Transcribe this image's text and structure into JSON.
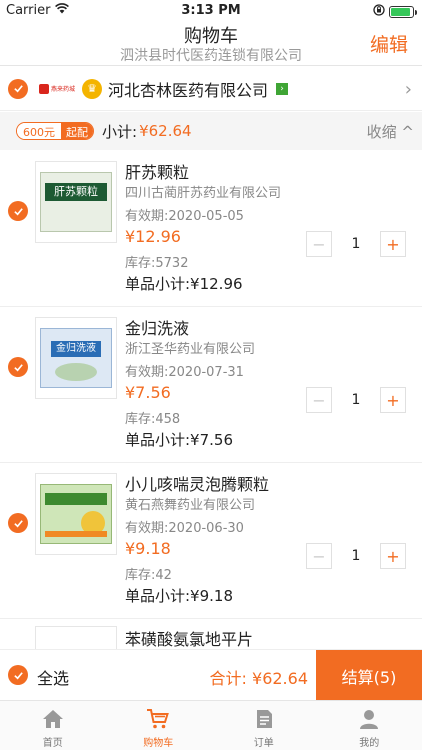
{
  "status_bar": {
    "carrier": "Carrier",
    "time": "3:13 PM",
    "battery_level": 0.9
  },
  "nav": {
    "title": "购物车",
    "subtitle": "泗洪县时代医药连锁有限公司",
    "edit_label": "编辑"
  },
  "shop": {
    "logo_text": "燕来药城",
    "name": "河北杏林医药有限公司"
  },
  "subtotal": {
    "min_amount": "600元",
    "min_tag": "起配",
    "label": "小计:",
    "value": "¥62.64",
    "collapse_label": "收缩"
  },
  "items": [
    {
      "name": "肝苏颗粒",
      "maker": "四川古蔺肝苏药业有限公司",
      "expiry": "有效期:2020-05-05",
      "price": "¥12.96",
      "stock": "库存:5732",
      "line_total": "单品小计:¥12.96",
      "qty": "1",
      "pic_label": "肝苏颗粒"
    },
    {
      "name": "金归洗液",
      "maker": "浙江圣华药业有限公司",
      "expiry": "有效期:2020-07-31",
      "price": "¥7.56",
      "stock": "库存:458",
      "line_total": "单品小计:¥7.56",
      "qty": "1",
      "pic_label": "金归洗液"
    },
    {
      "name": "小儿咳喘灵泡腾颗粒",
      "maker": "黄石燕舞药业有限公司",
      "expiry": "有效期:2020-06-30",
      "price": "¥9.18",
      "stock": "库存:42",
      "line_total": "单品小计:¥9.18",
      "qty": "1",
      "pic_label": ""
    }
  ],
  "peek_item": {
    "name": "苯磺酸氨氯地平片"
  },
  "bottom": {
    "select_all": "全选",
    "total": "合计: ¥62.64",
    "checkout": "结算(5)"
  },
  "tabs": [
    {
      "label": "首页",
      "icon": "home-icon"
    },
    {
      "label": "购物车",
      "icon": "cart-icon"
    },
    {
      "label": "订单",
      "icon": "order-icon"
    },
    {
      "label": "我的",
      "icon": "profile-icon"
    }
  ],
  "colors": {
    "accent": "#f26c22"
  }
}
